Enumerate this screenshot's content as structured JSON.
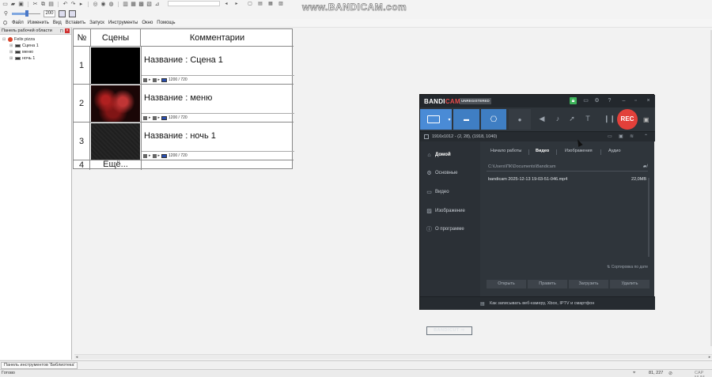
{
  "app": {
    "zoom": "200",
    "menu": [
      "Файл",
      "Изменить",
      "Вид",
      "Вставить",
      "Запуск",
      "Инструменты",
      "Окно",
      "Помощь"
    ]
  },
  "watermark": "www.BANDICAM.com",
  "workspace": {
    "title": "Панель рабочей области",
    "root": "Felix pizza",
    "items": [
      "Сцена 1",
      "меню",
      "ночь 1"
    ]
  },
  "scenes_table": {
    "headers": [
      "№",
      "Сцены",
      "Комментарии"
    ],
    "rows": [
      {
        "num": "1",
        "title": "Название : Сцена 1",
        "resolution": "1200  /  720"
      },
      {
        "num": "2",
        "title": "Название : меню",
        "resolution": "1200  /  720"
      },
      {
        "num": "3",
        "title": "Название : ночь 1",
        "resolution": "1200  /  720"
      }
    ],
    "last_row": {
      "num": "4",
      "label": "Ещё..."
    }
  },
  "library_tab": "Панель инструментов 'Библиотека'",
  "status": {
    "left": "Готово",
    "coords": "81, 227",
    "capslock": "CAP NUM"
  },
  "bandicam": {
    "logo_bandi": "BANDI",
    "logo_cam": "CAM",
    "unregistered": "UNREGISTERED",
    "rec_label": "REC",
    "area_info": "1916x1012 - (2, 28), (1918, 1040)",
    "nav": [
      "Домой",
      "Основные",
      "Видео",
      "Изображение",
      "О программе"
    ],
    "nav_active": "Домой",
    "tabs": [
      "Начало работы",
      "Видео",
      "Изображения",
      "Аудио"
    ],
    "tab_active": "Видео",
    "path": "C:\\Users\\ПК\\Documents\\Bandicam",
    "files": [
      {
        "name": "bandicam 2025-12-13 19-03-51-046.mp4",
        "size": "22,0MB"
      }
    ],
    "sort_label": "Сортировка по дате",
    "actions": [
      "Открыть",
      "Править",
      "Загрузить",
      "Удалить"
    ],
    "bandicut": "BANDICUT ⇨",
    "footer_text": "Как записывать веб-камеру, Xbox, IPTV и смартфон",
    "colors": {
      "accent": "#4a8bd6",
      "rec": "#e2403a",
      "bg": "#2b3036"
    }
  }
}
